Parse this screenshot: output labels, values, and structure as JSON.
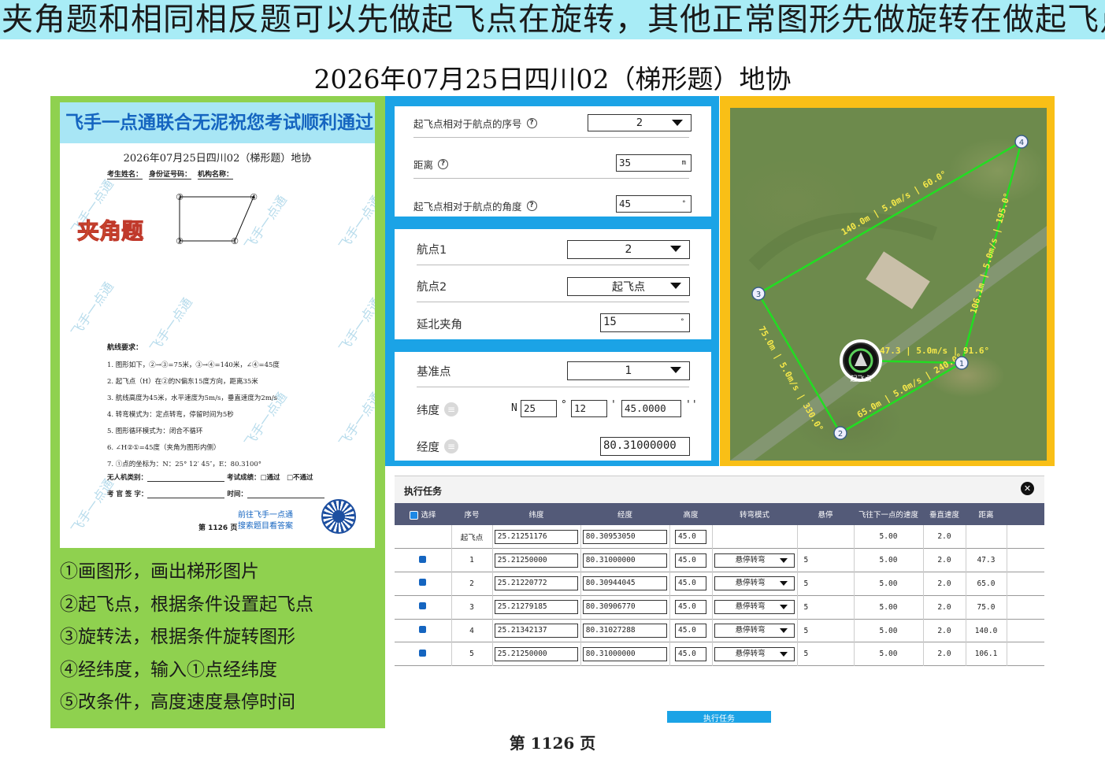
{
  "banner": "夹角题和相同相反题可以先做起飞点在旋转，其他正常图形先做旋转在做起飞点",
  "title": "2026年07月25日四川02（梯形题）地协",
  "paper": {
    "header": "飞手一点通联合无泥祝您考试顺利通过",
    "title": "2026年07月25日四川02（梯形题）地协",
    "fields": [
      "考生姓名：",
      "身份证号码：",
      "机构名称："
    ],
    "tag": "夹角题",
    "sketch_labels": [
      "③",
      "④",
      "②",
      "①"
    ],
    "watermark": "飞手一点通",
    "req_title": "航线要求：",
    "requirements": [
      "1. 图形如下，②→③=75米，③→④=140米，∠④=45度",
      "2. 起飞点（H）在②的N偏东15度方向，距离35米",
      "3. 航线高度为45米，水平速度为5m/s，垂直速度为2m/s",
      "4. 转弯模式为：定点转弯，停留时间为5秒",
      "5. 图形循环模式为：闭合不循环",
      "6. ∠H②①=45度（夹角为图形内侧）",
      "7. ①点的坐标为：N：25° 12′ 45″，E：80.3100°"
    ],
    "foot_type": "无人机类别：",
    "foot_result": "考试成绩：□通过　□不通过",
    "foot_sign": "考 官 签 字：",
    "foot_time": "时间：",
    "link_line1": "前往飞手一点通",
    "link_line2": "搜索题目看答案",
    "page": "第 1126 页"
  },
  "steps": [
    "①画图形，画出梯形图片",
    "②起飞点，根据条件设置起飞点",
    "③旋转法，根据条件旋转图形",
    "④经纬度，输入①点经纬度",
    "⑤改条件，高度速度悬停时间"
  ],
  "takeoff": {
    "seq_label": "起飞点相对于航点的序号",
    "seq_value": "2",
    "dist_label": "距离",
    "dist_value": "35",
    "dist_unit": "m",
    "angle_label": "起飞点相对于航点的角度",
    "angle_value": "45",
    "angle_unit": "°"
  },
  "rotate": {
    "wp1_label": "航点1",
    "wp1_value": "2",
    "wp2_label": "航点2",
    "wp2_value": "起飞点",
    "north_label": "延北夹角",
    "north_value": "15",
    "north_unit": "°"
  },
  "coords": {
    "base_label": "基准点",
    "base_value": "1",
    "lat_label": "纬度",
    "lat_dir": "N",
    "lat_deg": "25",
    "lat_min": "12",
    "lat_sec": "45.0000",
    "lon_label": "经度",
    "lon_value": "80.31000000"
  },
  "map": {
    "labels": [
      "140.0m | 5.0m/s | 60.0°",
      "106.1m | 5.0m/s | 195.0°",
      "75.0m | 5.0m/s | 330.0°",
      "65.0m | 5.0m/s | 240.0°",
      "47.3 | 5.0m/s | 91.6°"
    ],
    "points": [
      "1",
      "2",
      "3",
      "4"
    ],
    "home_label": "起飞点",
    "line_color": "#22dd22"
  },
  "tasks": {
    "title": "执行任务",
    "close": "✕",
    "columns": [
      "选择",
      "序号",
      "纬度",
      "经度",
      "高度",
      "转弯模式",
      "悬停",
      "飞往下一点的速度",
      "垂直速度",
      "距离"
    ],
    "rows": [
      {
        "seq": "起飞点",
        "lat": "25.21251176",
        "lon": "80.30953050",
        "alt": "45.0",
        "mode": "",
        "hover": "",
        "speed": "5.00",
        "vspeed": "2.0",
        "dist": ""
      },
      {
        "seq": "1",
        "lat": "25.21250000",
        "lon": "80.31000000",
        "alt": "45.0",
        "mode": "悬停转弯",
        "hover": "5",
        "speed": "5.00",
        "vspeed": "2.0",
        "dist": "47.3"
      },
      {
        "seq": "2",
        "lat": "25.21220772",
        "lon": "80.30944045",
        "alt": "45.0",
        "mode": "悬停转弯",
        "hover": "5",
        "speed": "5.00",
        "vspeed": "2.0",
        "dist": "65.0"
      },
      {
        "seq": "3",
        "lat": "25.21279185",
        "lon": "80.30906770",
        "alt": "45.0",
        "mode": "悬停转弯",
        "hover": "5",
        "speed": "5.00",
        "vspeed": "2.0",
        "dist": "75.0"
      },
      {
        "seq": "4",
        "lat": "25.21342137",
        "lon": "80.31027288",
        "alt": "45.0",
        "mode": "悬停转弯",
        "hover": "5",
        "speed": "5.00",
        "vspeed": "2.0",
        "dist": "140.0"
      },
      {
        "seq": "5",
        "lat": "25.21250000",
        "lon": "80.31000000",
        "alt": "45.0",
        "mode": "悬停转弯",
        "hover": "5",
        "speed": "5.00",
        "vspeed": "2.0",
        "dist": "106.1"
      }
    ],
    "exec_label": "执行任务"
  },
  "footer": "第 1126 页"
}
